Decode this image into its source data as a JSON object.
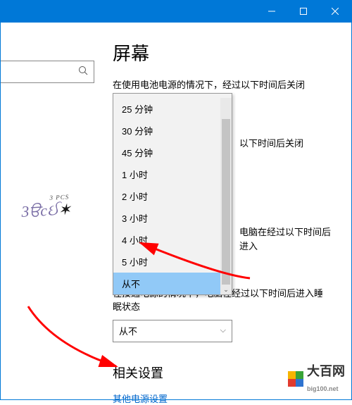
{
  "page_title": "屏幕",
  "captions": {
    "battery_off": "在使用电池电源的情况下，经过以下时间后关闭",
    "plugged_off": "以下时间后关闭",
    "battery_sleep": "电脑在经过以下时间后进入",
    "plugged_sleep": "在接通电源的情况下，电脑在经过以下时间后进入睡眠状态"
  },
  "dropdown_options": [
    "25 分钟",
    "30 分钟",
    "45 分钟",
    "1 小时",
    "2 小时",
    "3 小时",
    "4 小时",
    "5 小时",
    "从不"
  ],
  "dropdown_selected": "从不",
  "second_dropdown_value": "从不",
  "related_heading": "相关设置",
  "related_link": "其他电源设置",
  "watermark": {
    "brand_text": "大百网",
    "brand_sub": "big100.net"
  }
}
